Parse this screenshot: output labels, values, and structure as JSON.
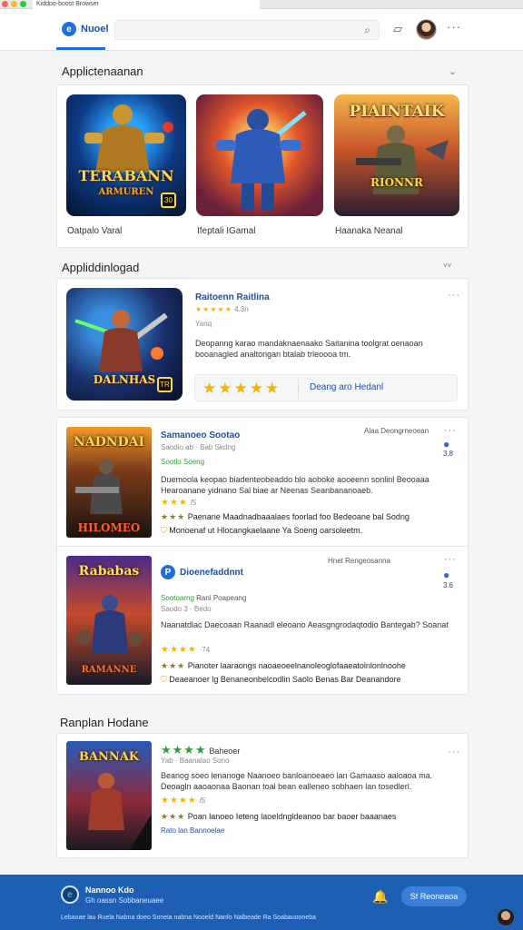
{
  "browser": {
    "tab_title": "Kiddoo-boost Browser"
  },
  "topbar": {
    "logo_text": "Nuoel"
  },
  "section1": {
    "title": "Applictenaanan",
    "games": [
      {
        "art_title": "TERABANN",
        "art_sub": "ARMUREN",
        "badge": "30",
        "label": "Oatpalo Varal",
        "colors": [
          "#0e3b85",
          "#1a80d8",
          "#e9a12a"
        ]
      },
      {
        "art_title": "",
        "art_sub": "",
        "badge": "",
        "label": "Ifeptali IGamal",
        "colors": [
          "#d23a2a",
          "#f0a13a",
          "#2d7bd6"
        ]
      },
      {
        "art_title": "PIAINTAIK",
        "art_sub": "RIONNR",
        "badge": "",
        "label": "Haanaka Neanal",
        "colors": [
          "#8a3b1a",
          "#e0a43a",
          "#3a2a4a"
        ]
      }
    ]
  },
  "section2": {
    "title": "Appliddinlogad",
    "chev": "˅˅",
    "featured": {
      "art_title": "DALNHAS",
      "badge": "TR",
      "name": "Raitoenn Raitlina",
      "stars": "★★★★★",
      "score": "4.3n",
      "meta": "Yanq",
      "desc": "Deopanng karao mandaknaenaako Saitanina toolgrat oenaoan booanagled analtongan btalab trleoooa tm.",
      "rating_stars": "★★★★★",
      "action": "Deang aro Hedanl"
    }
  },
  "list": [
    {
      "art_title": "NADNDAI",
      "art_sub": "HILOMEO",
      "name": "Samanoeo Sootao",
      "sub": "Saodio ab · Bab Skdng",
      "green": "Sootlo Soeng",
      "top_right": "Alaa Deongrneoean",
      "chat": "3.8",
      "desc": "Duemoola keopao biadenteobeaddo blo aoboke aooeenn sonlinl Beooaaa Hearoanane yidnano Sal biae ar Neenas Seanbananoaeb.",
      "stars1": "★★★",
      "stars1_score": "/5",
      "stars2": "★★★",
      "stars2_text": "Paenane Maadnadbaaalaes foorlad foo Bedeoane bal Sodng",
      "foot": "Monoenaf ut Hlocangkaelaane Ya Soeng oarsoleetm."
    },
    {
      "art_title": "Rababas",
      "art_sub": "RAMANNE",
      "name": "Dioenefaddnnt",
      "sub": "Saodo 3 · Bedo",
      "green": "Sootoarng",
      "green2": "Ranl Poapeang",
      "top_right": "Hnet Rengeosanna",
      "chat": "3.6",
      "desc": "Naanatdlac Daecoaan Raanadl eleoano Aeasgngrodaqtodio Bantegab? Soanat",
      "stars1": "★★★★",
      "stars1_score": "·74",
      "stars2": "★★★",
      "stars2_text": "Pianoter laaraongs naoaeoeelnanoleoglofaaeatolnlonlnoohe",
      "foot": "Deaeanoer lg Benaneonbelcodlin Saolo Benas Bar Deanandore"
    }
  ],
  "section3": {
    "title": "Ranplan Hodane",
    "item": {
      "art_title": "BANNAK",
      "stars_green": "★★★★",
      "name": "Baheoer",
      "meta": "Yab · Baanalao Sono",
      "desc": "Beanog soeo lenanoge Naanoeo banloanoeaeo lan Gamaaso aaloaoa ma. Deoagln aaoaonaa Baonan toal bean ealleneo sobhaen lan tosedlerl.",
      "stars1": "★★★★",
      "stars1_score": "/5",
      "stars2": "★★★",
      "stars2_text": "Poan lanoeo Ieteng laoeldngldeanoo bar baoer baaanaes",
      "foot": "Rato lan Bannoelae"
    }
  },
  "footer": {
    "title": "Nannoo Kdo",
    "sub": "Gh oassn Sobbaneuaee",
    "links": "Lebaoae lau Ruela Nabna doeo Soneia nabna Nooeld Nanfo Nalbeade Ra Soabauooneba",
    "button": "Sf Reoneaoa"
  }
}
